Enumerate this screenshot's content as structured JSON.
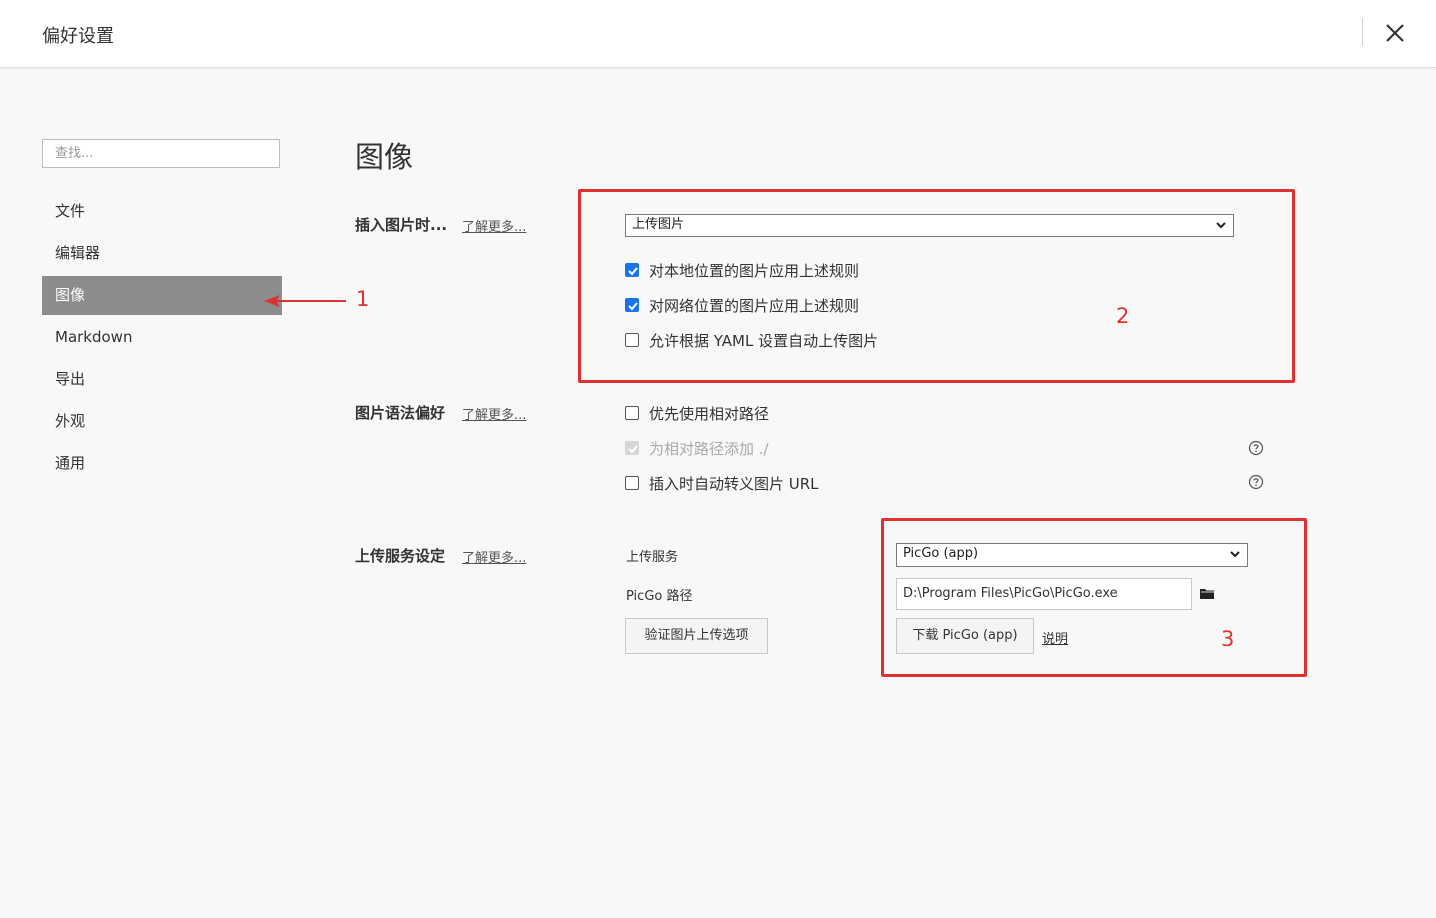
{
  "window": {
    "title": "偏好设置"
  },
  "search": {
    "placeholder": "查找..."
  },
  "sidebar": {
    "items": [
      {
        "label": "文件"
      },
      {
        "label": "编辑器"
      },
      {
        "label": "图像"
      },
      {
        "label": "Markdown"
      },
      {
        "label": "导出"
      },
      {
        "label": "外观"
      },
      {
        "label": "通用"
      }
    ],
    "active_index": 2
  },
  "main": {
    "title": "图像",
    "insert": {
      "label": "插入图片时...",
      "learn_more": "了解更多...",
      "select_value": "上传图片",
      "options": [
        {
          "label": "对本地位置的图片应用上述规则",
          "checked": true
        },
        {
          "label": "对网络位置的图片应用上述规则",
          "checked": true
        },
        {
          "label": "允许根据 YAML 设置自动上传图片",
          "checked": false
        }
      ]
    },
    "syntax": {
      "label": "图片语法偏好",
      "learn_more": "了解更多...",
      "options": [
        {
          "label": "优先使用相对路径",
          "checked": false
        },
        {
          "label": "为相对路径添加 ./",
          "checked": true,
          "disabled": true
        },
        {
          "label": "插入时自动转义图片 URL",
          "checked": false
        }
      ]
    },
    "upload": {
      "label": "上传服务设定",
      "learn_more": "了解更多...",
      "service_label": "上传服务",
      "service_value": "PicGo (app)",
      "path_label": "PicGo 路径",
      "path_value": "D:\\Program Files\\PicGo\\PicGo.exe",
      "verify_button": "验证图片上传选项",
      "download_button": "下载 PicGo (app)",
      "explain_link": "说明"
    }
  },
  "annotations": {
    "n1": "1",
    "n2": "2",
    "n3": "3"
  },
  "colors": {
    "annotation": "#e03131",
    "checkbox": "#1a73e8",
    "sidebar_active": "#8c8c8c"
  },
  "icons": [
    "close-icon",
    "chevron-down-icon",
    "checkmark-icon",
    "help-circle-icon",
    "folder-icon",
    "arrow-left-icon"
  ]
}
